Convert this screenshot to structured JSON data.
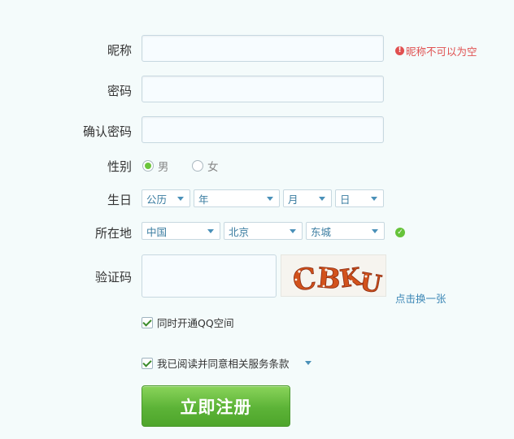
{
  "nickname": {
    "label": "昵称",
    "value": "",
    "error": "昵称不可以为空",
    "error_icon": "!"
  },
  "password": {
    "label": "密码",
    "value": ""
  },
  "confirm_password": {
    "label": "确认密码",
    "value": ""
  },
  "gender": {
    "label": "性别",
    "options": [
      "男",
      "女"
    ],
    "selected": "男"
  },
  "birthday": {
    "label": "生日",
    "calendar": "公历",
    "year": "年",
    "month": "月",
    "day": "日"
  },
  "location": {
    "label": "所在地",
    "country": "中国",
    "province": "北京",
    "district": "东城",
    "status_icon": "✓"
  },
  "captcha": {
    "label": "验证码",
    "value": "",
    "image_text": "CBKU",
    "refresh_label": "点击换一张"
  },
  "options": {
    "qzone_label": "同时开通QQ空间",
    "qzone_checked": true,
    "terms_label": "我已阅读并同意相关服务条款",
    "terms_checked": true
  },
  "submit_label": "立即注册",
  "colors": {
    "accent_green": "#5cb337",
    "error_red": "#e05050",
    "link_blue": "#3a86b5"
  }
}
